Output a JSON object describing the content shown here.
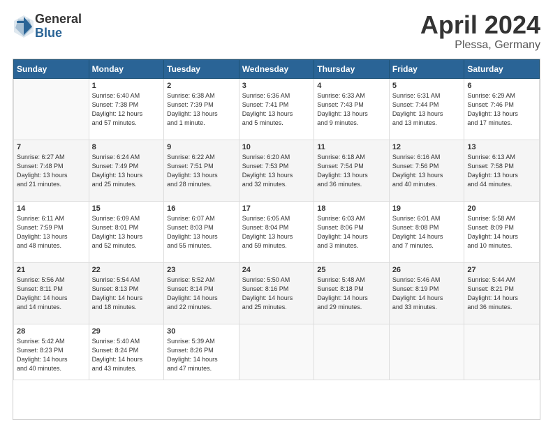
{
  "header": {
    "logo_general": "General",
    "logo_blue": "Blue",
    "title": "April 2024",
    "location": "Plessa, Germany"
  },
  "days_of_week": [
    "Sunday",
    "Monday",
    "Tuesday",
    "Wednesday",
    "Thursday",
    "Friday",
    "Saturday"
  ],
  "weeks": [
    [
      {
        "day": "",
        "info": ""
      },
      {
        "day": "1",
        "info": "Sunrise: 6:40 AM\nSunset: 7:38 PM\nDaylight: 12 hours\nand 57 minutes."
      },
      {
        "day": "2",
        "info": "Sunrise: 6:38 AM\nSunset: 7:39 PM\nDaylight: 13 hours\nand 1 minute."
      },
      {
        "day": "3",
        "info": "Sunrise: 6:36 AM\nSunset: 7:41 PM\nDaylight: 13 hours\nand 5 minutes."
      },
      {
        "day": "4",
        "info": "Sunrise: 6:33 AM\nSunset: 7:43 PM\nDaylight: 13 hours\nand 9 minutes."
      },
      {
        "day": "5",
        "info": "Sunrise: 6:31 AM\nSunset: 7:44 PM\nDaylight: 13 hours\nand 13 minutes."
      },
      {
        "day": "6",
        "info": "Sunrise: 6:29 AM\nSunset: 7:46 PM\nDaylight: 13 hours\nand 17 minutes."
      }
    ],
    [
      {
        "day": "7",
        "info": "Sunrise: 6:27 AM\nSunset: 7:48 PM\nDaylight: 13 hours\nand 21 minutes."
      },
      {
        "day": "8",
        "info": "Sunrise: 6:24 AM\nSunset: 7:49 PM\nDaylight: 13 hours\nand 25 minutes."
      },
      {
        "day": "9",
        "info": "Sunrise: 6:22 AM\nSunset: 7:51 PM\nDaylight: 13 hours\nand 28 minutes."
      },
      {
        "day": "10",
        "info": "Sunrise: 6:20 AM\nSunset: 7:53 PM\nDaylight: 13 hours\nand 32 minutes."
      },
      {
        "day": "11",
        "info": "Sunrise: 6:18 AM\nSunset: 7:54 PM\nDaylight: 13 hours\nand 36 minutes."
      },
      {
        "day": "12",
        "info": "Sunrise: 6:16 AM\nSunset: 7:56 PM\nDaylight: 13 hours\nand 40 minutes."
      },
      {
        "day": "13",
        "info": "Sunrise: 6:13 AM\nSunset: 7:58 PM\nDaylight: 13 hours\nand 44 minutes."
      }
    ],
    [
      {
        "day": "14",
        "info": "Sunrise: 6:11 AM\nSunset: 7:59 PM\nDaylight: 13 hours\nand 48 minutes."
      },
      {
        "day": "15",
        "info": "Sunrise: 6:09 AM\nSunset: 8:01 PM\nDaylight: 13 hours\nand 52 minutes."
      },
      {
        "day": "16",
        "info": "Sunrise: 6:07 AM\nSunset: 8:03 PM\nDaylight: 13 hours\nand 55 minutes."
      },
      {
        "day": "17",
        "info": "Sunrise: 6:05 AM\nSunset: 8:04 PM\nDaylight: 13 hours\nand 59 minutes."
      },
      {
        "day": "18",
        "info": "Sunrise: 6:03 AM\nSunset: 8:06 PM\nDaylight: 14 hours\nand 3 minutes."
      },
      {
        "day": "19",
        "info": "Sunrise: 6:01 AM\nSunset: 8:08 PM\nDaylight: 14 hours\nand 7 minutes."
      },
      {
        "day": "20",
        "info": "Sunrise: 5:58 AM\nSunset: 8:09 PM\nDaylight: 14 hours\nand 10 minutes."
      }
    ],
    [
      {
        "day": "21",
        "info": "Sunrise: 5:56 AM\nSunset: 8:11 PM\nDaylight: 14 hours\nand 14 minutes."
      },
      {
        "day": "22",
        "info": "Sunrise: 5:54 AM\nSunset: 8:13 PM\nDaylight: 14 hours\nand 18 minutes."
      },
      {
        "day": "23",
        "info": "Sunrise: 5:52 AM\nSunset: 8:14 PM\nDaylight: 14 hours\nand 22 minutes."
      },
      {
        "day": "24",
        "info": "Sunrise: 5:50 AM\nSunset: 8:16 PM\nDaylight: 14 hours\nand 25 minutes."
      },
      {
        "day": "25",
        "info": "Sunrise: 5:48 AM\nSunset: 8:18 PM\nDaylight: 14 hours\nand 29 minutes."
      },
      {
        "day": "26",
        "info": "Sunrise: 5:46 AM\nSunset: 8:19 PM\nDaylight: 14 hours\nand 33 minutes."
      },
      {
        "day": "27",
        "info": "Sunrise: 5:44 AM\nSunset: 8:21 PM\nDaylight: 14 hours\nand 36 minutes."
      }
    ],
    [
      {
        "day": "28",
        "info": "Sunrise: 5:42 AM\nSunset: 8:23 PM\nDaylight: 14 hours\nand 40 minutes."
      },
      {
        "day": "29",
        "info": "Sunrise: 5:40 AM\nSunset: 8:24 PM\nDaylight: 14 hours\nand 43 minutes."
      },
      {
        "day": "30",
        "info": "Sunrise: 5:39 AM\nSunset: 8:26 PM\nDaylight: 14 hours\nand 47 minutes."
      },
      {
        "day": "",
        "info": ""
      },
      {
        "day": "",
        "info": ""
      },
      {
        "day": "",
        "info": ""
      },
      {
        "day": "",
        "info": ""
      }
    ]
  ]
}
